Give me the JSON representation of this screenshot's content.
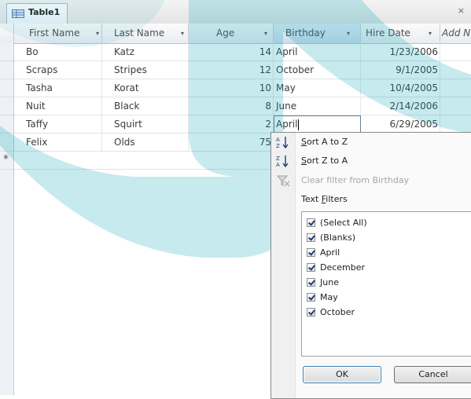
{
  "window": {
    "tab_title": "Table1",
    "close_glyph": "×"
  },
  "columns": [
    {
      "label": "First Name",
      "arrow": "▾"
    },
    {
      "label": "Last Name",
      "arrow": "▾"
    },
    {
      "label": "Age",
      "arrow": "▾"
    },
    {
      "label": "Birthday",
      "arrow": "▾"
    },
    {
      "label": "Hire Date",
      "arrow": "▾"
    },
    {
      "label": "Add N"
    }
  ],
  "rows": [
    {
      "first": "Bo",
      "last": "Katz",
      "age": "14",
      "birthday": "April",
      "hire": "1/23/2006"
    },
    {
      "first": "Scraps",
      "last": "Stripes",
      "age": "12",
      "birthday": "October",
      "hire": "9/1/2005"
    },
    {
      "first": "Tasha",
      "last": "Korat",
      "age": "10",
      "birthday": "May",
      "hire": "10/4/2005"
    },
    {
      "first": "Nuit",
      "last": "Black",
      "age": "8",
      "birthday": "June",
      "hire": "2/14/2006"
    },
    {
      "first": "Taffy",
      "last": "Squirt",
      "age": "2",
      "birthday": "April",
      "hire": "6/29/2005"
    },
    {
      "first": "Felix",
      "last": "Olds",
      "age": "75",
      "birthday": "",
      "hire": ""
    }
  ],
  "new_row_marker": "*",
  "filter_menu": {
    "sort_asc": {
      "prefix": "S",
      "rest": "ort A to Z"
    },
    "sort_desc": {
      "prefix": "S",
      "rest": "ort Z to A"
    },
    "clear_filter": "Clear filter from Birthday",
    "text_filters": {
      "before": "Text ",
      "accel": "F",
      "after": "ilters"
    },
    "options": [
      {
        "label": "(Select All)",
        "checked": true
      },
      {
        "label": "(Blanks)",
        "checked": true
      },
      {
        "label": "April",
        "checked": true
      },
      {
        "label": "December",
        "checked": true
      },
      {
        "label": "June",
        "checked": true
      },
      {
        "label": "May",
        "checked": true
      },
      {
        "label": "October",
        "checked": true
      }
    ],
    "ok_label": "OK",
    "cancel_label": "Cancel"
  },
  "colors": {
    "watermark": "#00a0b0",
    "grid_header_top": "#fbfbfb",
    "grid_header_bottom": "#e9ecf1",
    "menu_background": "#fafafa"
  },
  "icons": [
    "table-icon",
    "sort-ascending-icon",
    "sort-descending-icon",
    "clear-filter-icon",
    "checkbox-checked-icon",
    "dropdown-arrow-icon"
  ]
}
